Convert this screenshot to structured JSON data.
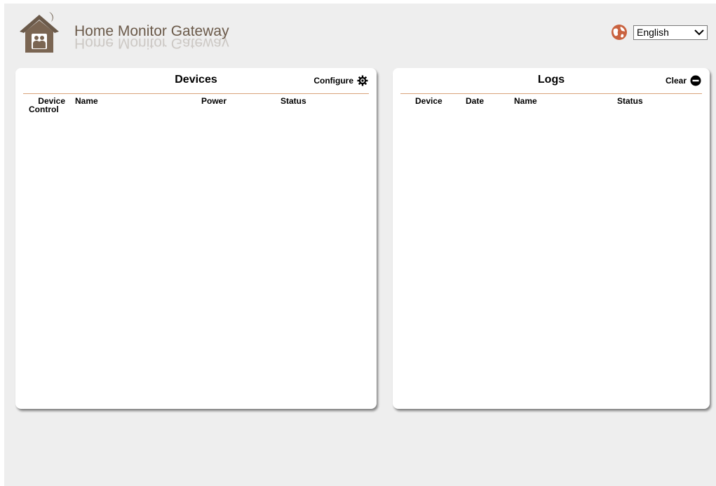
{
  "header": {
    "title": "Home Monitor Gateway",
    "language": {
      "selected": "English",
      "icon": "globe-icon"
    }
  },
  "devices_panel": {
    "title": "Devices",
    "action_label": "Configure",
    "action_icon": "gear-icon",
    "columns": {
      "device_control_line1": "Device",
      "device_control_line2": "Control",
      "name": "Name",
      "power": "Power",
      "status": "Status"
    }
  },
  "logs_panel": {
    "title": "Logs",
    "action_label": "Clear",
    "action_icon": "minus-circle-icon",
    "columns": {
      "device": "Device",
      "date": "Date",
      "name": "Name",
      "status": "Status"
    }
  },
  "colors": {
    "background": "#eeeeee",
    "brand_brown": "#6b5a4a",
    "divider": "#d9a37a",
    "globe_accent": "#c9623f"
  }
}
